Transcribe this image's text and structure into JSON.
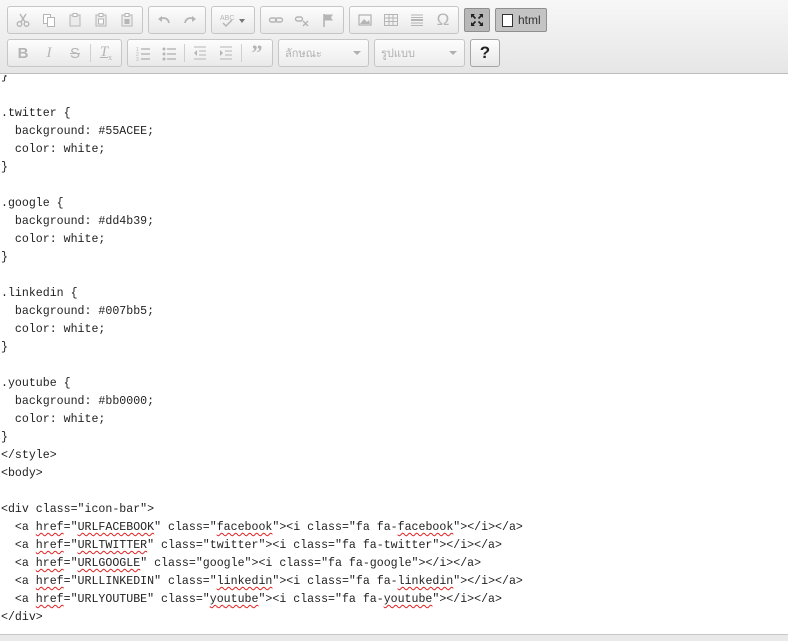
{
  "toolbar": {
    "style_placeholder": "ลักษณะ",
    "format_placeholder": "รูปแบบ",
    "source_label": "html",
    "help_label": "?"
  },
  "code_lines": [
    "}",
    "",
    ".twitter {",
    "  background: #55ACEE;",
    "  color: white;",
    "}",
    "",
    ".google {",
    "  background: #dd4b39;",
    "  color: white;",
    "}",
    "",
    ".linkedin {",
    "  background: #007bb5;",
    "  color: white;",
    "}",
    "",
    ".youtube {",
    "  background: #bb0000;",
    "  color: white;",
    "}",
    "</style>",
    "<body>",
    "",
    "<div class=\"icon-bar\">",
    "  <a href=\"URLFACEBOOK\" class=\"facebook\"><i class=\"fa fa-facebook\"></i></a>",
    "  <a href=\"URLTWITTER\" class=\"twitter\"><i class=\"fa fa-twitter\"></i></a>",
    "  <a href=\"URLGOOGLE\" class=\"google\"><i class=\"fa fa-google\"></i></a>",
    "  <a href=\"URLLINKEDIN\" class=\"linkedin\"><i class=\"fa fa-linkedin\"></i></a>",
    "  <a href=\"URLYOUTUBE\" class=\"youtube\"><i class=\"fa fa-youtube\"></i></a>",
    "</div>"
  ],
  "spellcheck_words": [
    "href",
    "URLFACEBOOK",
    "facebook",
    "URLTWITTER",
    "URLGOOGLE",
    "linkedin",
    "youtube"
  ],
  "colors": {
    "toolbar_bg": "#e6e6e6",
    "active_button": "#b8b8b8",
    "spell_error": "#e02020"
  }
}
